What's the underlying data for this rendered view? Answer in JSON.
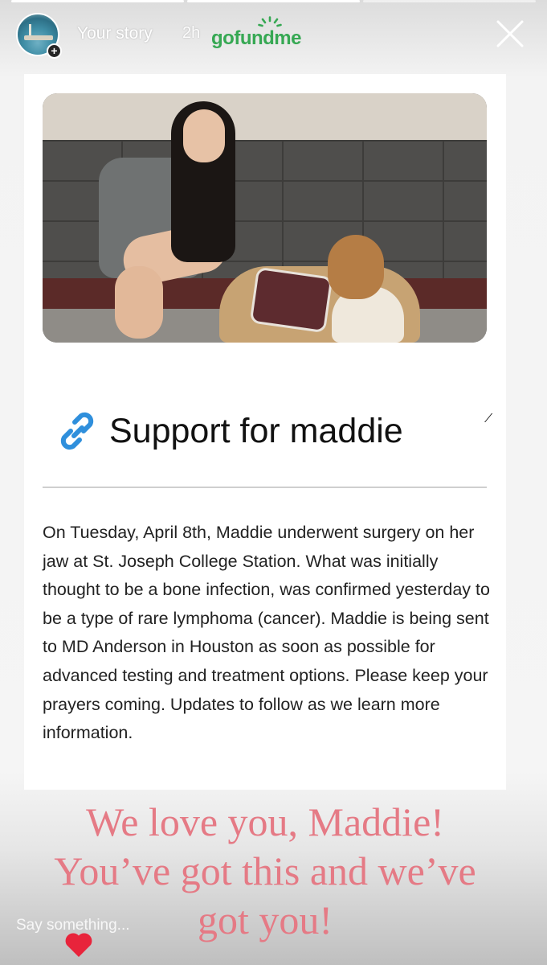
{
  "story": {
    "username": "Your story",
    "time": "2h",
    "progress_segments": [
      true,
      true,
      false
    ],
    "brand_logo": "gofundme"
  },
  "card": {
    "image_alt": "",
    "title": "Support for maddie",
    "stray_mark": "⁄",
    "body": "On Tuesday, April 8th, Maddie underwent surgery on her jaw at St. Joseph College Station. What was initially thought to be a bone infection, was confirmed yesterday to be a type of rare lymphoma (cancer). Maddie is being sent to MD Anderson in Houston as soon as possible for advanced testing and treatment options. Please keep your prayers coming. Updates to follow as we learn more information."
  },
  "overlay": {
    "caption": "We love you, Maddie! You’ve got this and we’ve got you!",
    "caption_color": "#e57a85"
  },
  "reply": {
    "placeholder": "Say something..."
  },
  "colors": {
    "brand_green": "#36a853",
    "link_blue": "#2f8fdc",
    "heart_red": "#e8243b"
  }
}
